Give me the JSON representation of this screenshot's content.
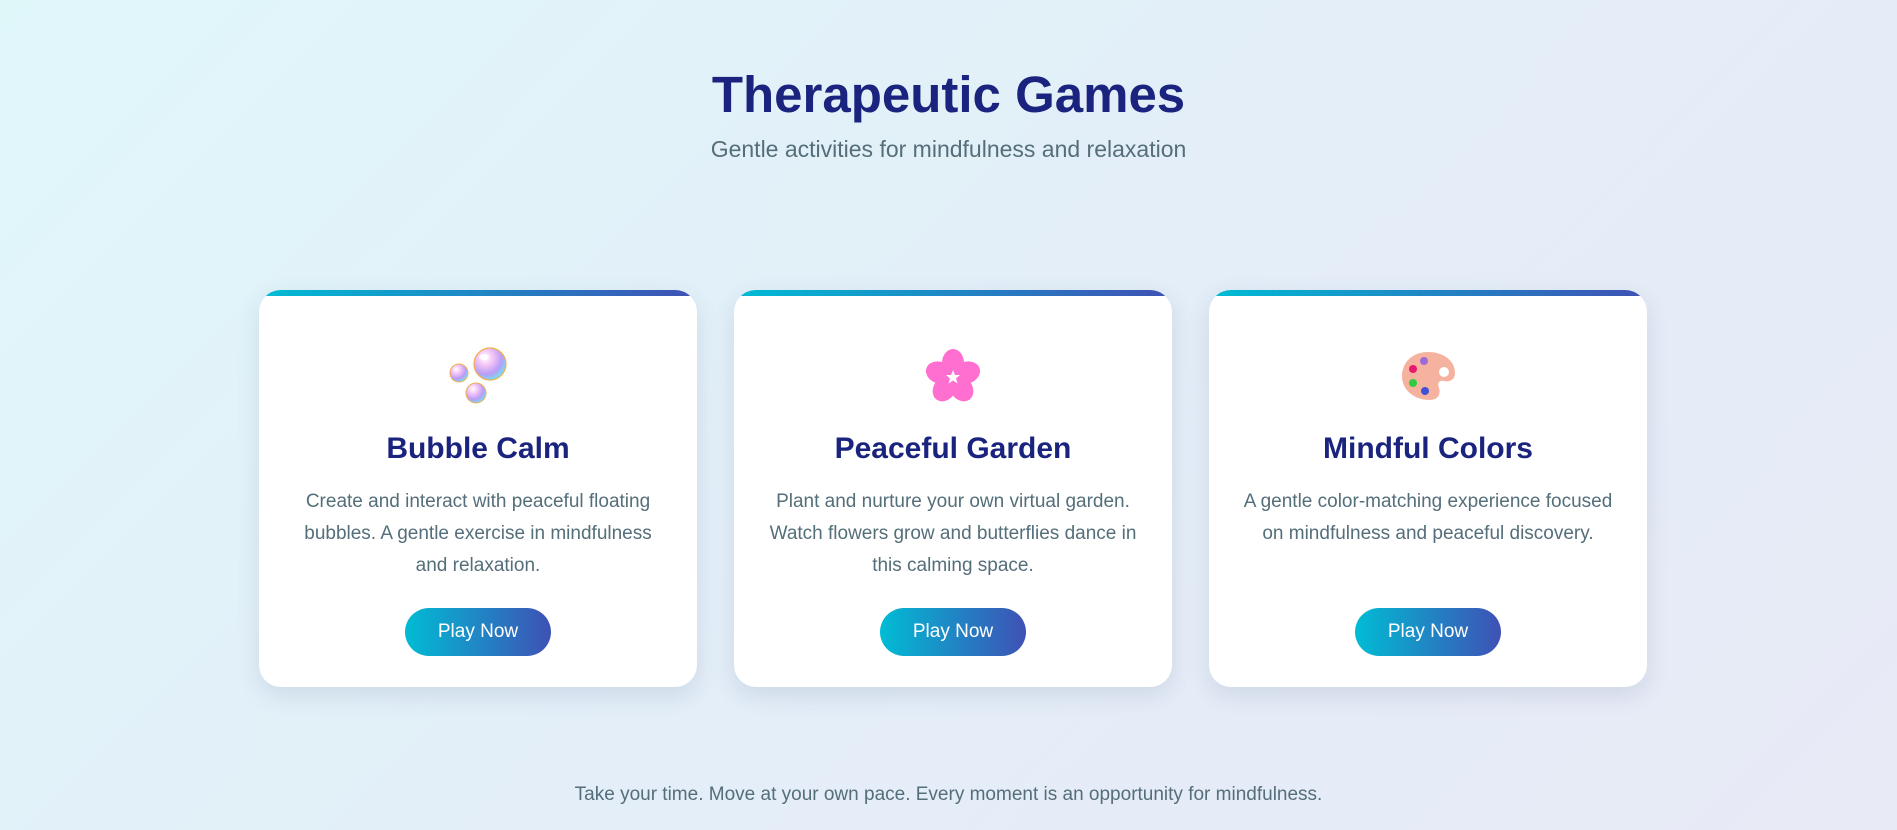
{
  "header": {
    "title": "Therapeutic Games",
    "subtitle": "Gentle activities for mindfulness and relaxation"
  },
  "cards": [
    {
      "icon": "bubbles-icon",
      "title": "Bubble Calm",
      "description": "Create and interact with peaceful floating bubbles. A gentle exercise in mindfulness and relaxation.",
      "button_label": "Play Now"
    },
    {
      "icon": "cherry-blossom-icon",
      "title": "Peaceful Garden",
      "description": "Plant and nurture your own virtual garden. Watch flowers grow and butterflies dance in this calming space.",
      "button_label": "Play Now"
    },
    {
      "icon": "artist-palette-icon",
      "title": "Mindful Colors",
      "description": "A gentle color-matching experience focused on mindfulness and peaceful discovery.",
      "button_label": "Play Now"
    }
  ],
  "footer": {
    "note": "Take your time. Move at your own pace. Every moment is an opportunity for mindfulness."
  },
  "colors": {
    "title": "#1a237e",
    "text": "#546e7a",
    "accent_start": "#00bcd4",
    "accent_end": "#3f51b5",
    "card_background": "#ffffff"
  }
}
